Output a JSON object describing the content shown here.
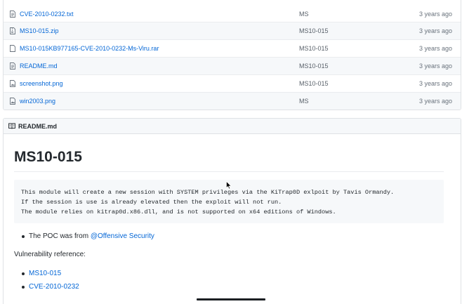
{
  "files": [
    {
      "name": "CVE-2010-0232.txt",
      "message": "MS",
      "age": "3 years ago",
      "icon": "file-text-icon"
    },
    {
      "name": "MS10-015.zip",
      "message": "MS10-015",
      "age": "3 years ago",
      "icon": "file-zip-icon"
    },
    {
      "name": "MS10-015KB977165-CVE-2010-0232-Ms-Viru.rar",
      "message": "MS10-015",
      "age": "3 years ago",
      "icon": "file-icon"
    },
    {
      "name": "README.md",
      "message": "MS10-015",
      "age": "3 years ago",
      "icon": "file-text-icon"
    },
    {
      "name": "screenshot.png",
      "message": "MS10-015",
      "age": "3 years ago",
      "icon": "file-media-icon"
    },
    {
      "name": "win2003.png",
      "message": "MS",
      "age": "3 years ago",
      "icon": "file-media-icon"
    }
  ],
  "readme": {
    "header": "README.md",
    "title": "MS10-015",
    "code": "This module will create a new session with SYSTEM privileges via the KiTrap0D exlpoit by Tavis Ormandy.\nIf the session is use is already elevated then the exploit will not run.\nThe module relies on kitrap0d.x86.dll, and is not supported on x64 editions of Windows.",
    "poc_prefix": "The POC was from ",
    "poc_link": "@Offensive Security",
    "vuln_heading": "Vulnerability reference:",
    "references": [
      "MS10-015",
      "CVE-2010-0232"
    ]
  },
  "colors": {
    "link": "#0366d6",
    "row_alt": "#f6f8fa",
    "border": "#dfe2e5"
  }
}
